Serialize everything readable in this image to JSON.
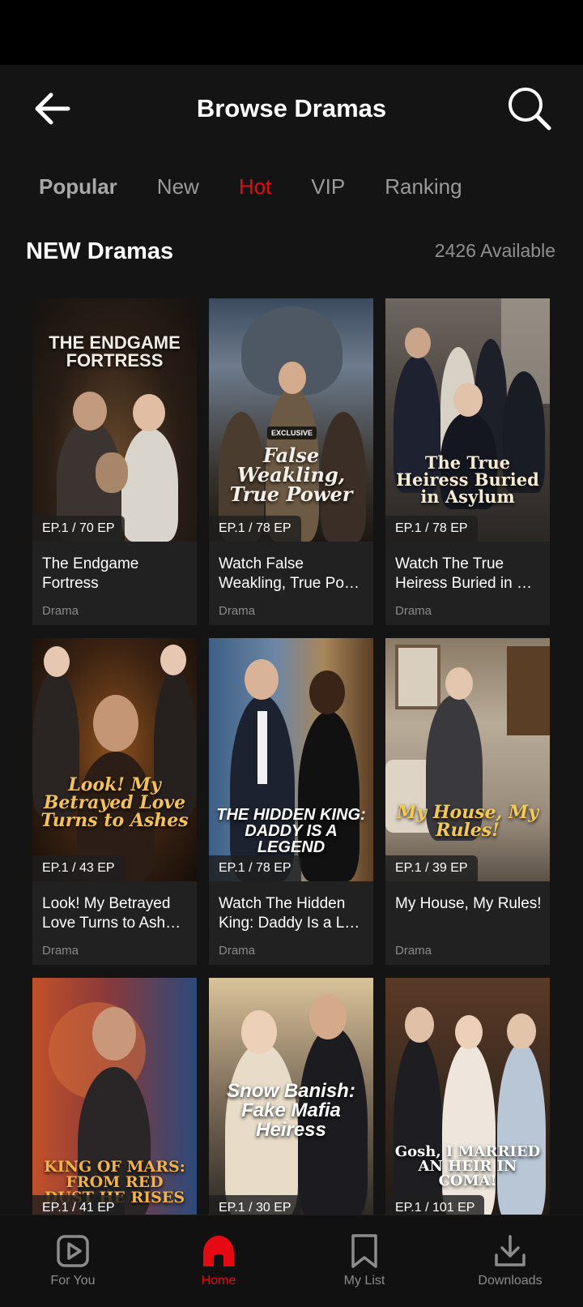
{
  "header": {
    "title": "Browse Dramas"
  },
  "tabs": [
    "Popular",
    "New",
    "Hot",
    "VIP",
    "Ranking"
  ],
  "section": {
    "title": "NEW Dramas",
    "count": "2426 Available"
  },
  "cards": [
    {
      "poster_text": "THE ENDGAME FORTRESS",
      "episodes": "EP.1 / 70 EP",
      "title": "The Endgame Fortress",
      "genre": "Drama"
    },
    {
      "poster_text": "False Weakling, True Power",
      "episodes": "EP.1 / 78 EP",
      "title": "Watch False Weakling, True Po…",
      "genre": "Drama",
      "badge": "EXCLUSIVE"
    },
    {
      "poster_text": "The True Heiress Buried in Asylum",
      "episodes": "EP.1 / 78 EP",
      "title": "Watch The True Heiress Buried in …",
      "genre": "Drama"
    },
    {
      "poster_text": "Look! My Betrayed Love Turns to Ashes",
      "episodes": "EP.1 / 43 EP",
      "title": "Look! My Betrayed Love Turns to Ash…",
      "genre": "Drama"
    },
    {
      "poster_text": "THE HIDDEN KING: DADDY IS A LEGEND",
      "episodes": "EP.1 / 78 EP",
      "title": "Watch The Hidden King: Daddy Is a L…",
      "genre": "Drama"
    },
    {
      "poster_text": "My House, My Rules!",
      "episodes": "EP.1 / 39 EP",
      "title": "My House, My Rules!",
      "genre": "Drama"
    },
    {
      "poster_text": "KING OF MARS: FROM RED DUST HE RISES",
      "episodes": "EP.1 / 41 EP",
      "title": "",
      "genre": ""
    },
    {
      "poster_text": "Snow Banish: Fake Mafia Heiress",
      "episodes": "EP.1 / 30 EP",
      "title": "",
      "genre": ""
    },
    {
      "poster_text": "Gosh, I MARRIED AN HEIR IN COMA!",
      "episodes": "EP.1 / 101 EP",
      "title": "",
      "genre": ""
    }
  ],
  "bottom_nav": [
    {
      "label": "For You",
      "icon": "play-square-icon"
    },
    {
      "label": "Home",
      "icon": "home-icon"
    },
    {
      "label": "My List",
      "icon": "bookmark-icon"
    },
    {
      "label": "Downloads",
      "icon": "download-icon"
    }
  ],
  "colors": {
    "accent": "#e50914",
    "background": "#141414",
    "card": "#212121"
  }
}
